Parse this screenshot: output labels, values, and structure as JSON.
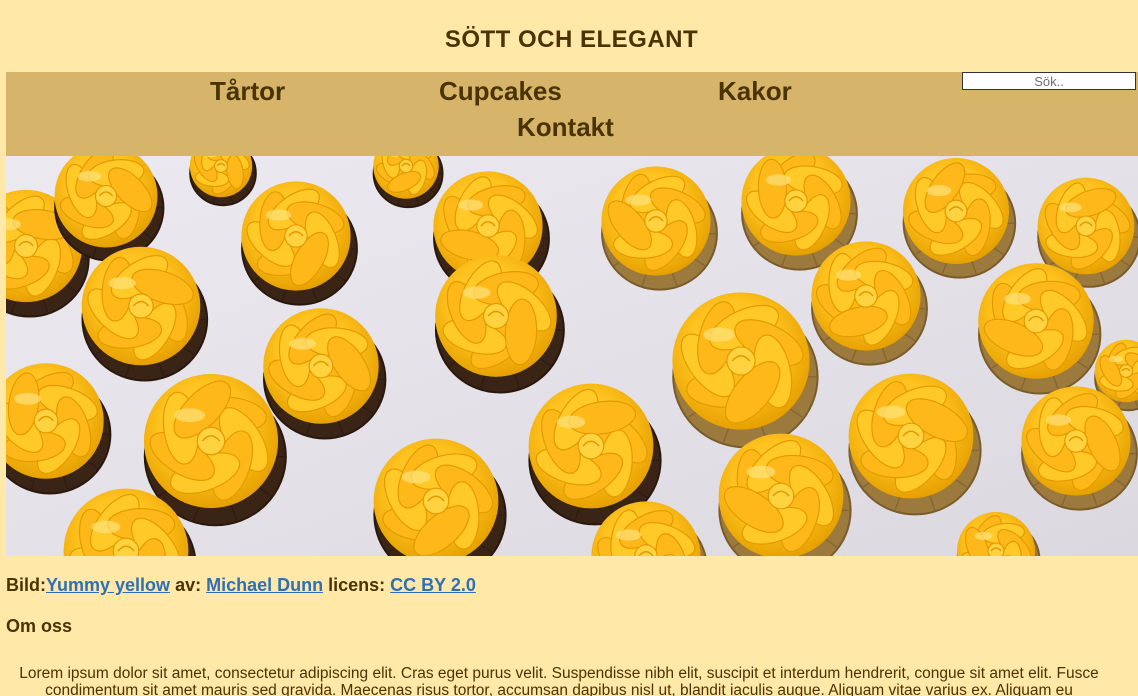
{
  "header": {
    "site_title": "SÖTT OCH ELEGANT"
  },
  "nav": {
    "items": [
      {
        "label": "Tårtor"
      },
      {
        "label": "Cupcakes"
      },
      {
        "label": "Kakor"
      },
      {
        "label": "Kontakt"
      }
    ],
    "search": {
      "placeholder": "Sök.."
    }
  },
  "hero": {
    "image_alt": "Yummy yellow"
  },
  "credit": {
    "prefix": "Bild:",
    "title_link": "Yummy yellow",
    "author_prefix": " av: ",
    "author_link": "Michael Dunn",
    "license_prefix": " licens: ",
    "license_link": "CC BY 2.0"
  },
  "about": {
    "heading": "Om oss",
    "text": "Lorem ipsum dolor sit amet, consectetur adipiscing elit. Cras eget purus velit. Suspendisse nibh elit, suscipit et interdum hendrerit, congue sit amet elit. Fusce condimentum sit amet mauris sed gravida. Maecenas risus tortor, accumsan dapibus nisl ut, blandit iaculis augue. Aliquam vitae varius ex. Aliquam eu"
  },
  "colors": {
    "page_background": "#FFE8A8",
    "nav_background": "#D6B56A",
    "text": "#4A3300",
    "link": "#2E6FB7",
    "frosting": "#FFC21F"
  }
}
